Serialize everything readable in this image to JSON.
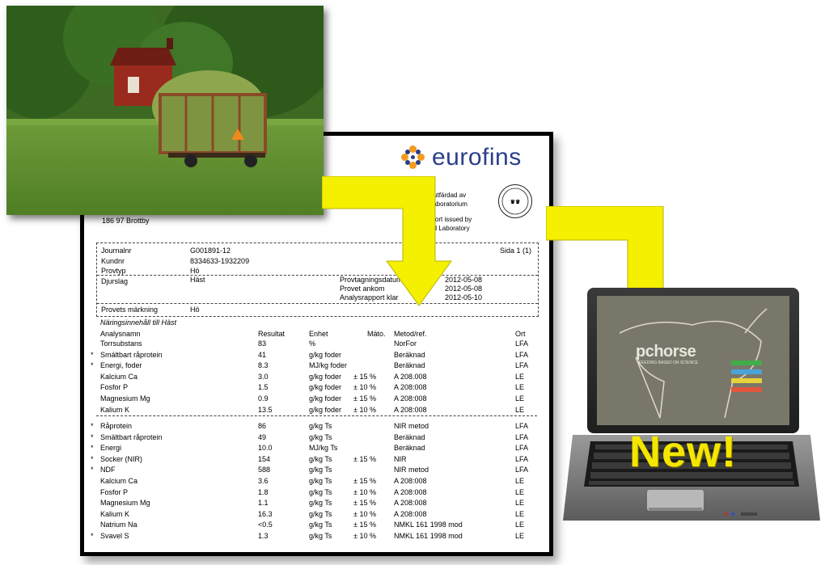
{
  "brand": {
    "name": "eurofins",
    "accreditation_text": [
      "rt utfärdad av",
      "t laboratorium",
      "pport issued by",
      "ted Laboratory"
    ],
    "seal_text": "SWEDAC ACKREDITERING",
    "address": "186 97  Brottby"
  },
  "header": {
    "page": "Sida 1 (1)",
    "rows": [
      {
        "label": "Journalnr",
        "value": "G001891-12"
      },
      {
        "label": "Kundnr",
        "value": "8334633-1932209"
      },
      {
        "label": "Provtyp",
        "value": "Hö"
      },
      {
        "label": "Djurslag",
        "value": "Häst"
      }
    ],
    "dates": [
      {
        "label": "Provtagningsdatum",
        "value": "2012-05-08"
      },
      {
        "label": "Provet ankom",
        "value": "2012-05-08"
      },
      {
        "label": "Analysrapport klar",
        "value": "2012-05-10"
      }
    ],
    "marking_label": "Provets märkning",
    "marking_value": "Hö"
  },
  "section_title": "Näringsinnehåll till Häst",
  "columns": [
    "Analysnamn",
    "Resultat",
    "Enhet",
    "Mäto.",
    "Metod/ref.",
    "Ort"
  ],
  "group1": [
    {
      "star": "",
      "name": "Torrsubstans",
      "result": "83",
      "unit": "%",
      "mato": "",
      "method": "NorFor",
      "ort": "LFA"
    },
    {
      "star": "*",
      "name": "Smältbart råprotein",
      "result": "41",
      "unit": "g/kg foder",
      "mato": "",
      "method": "Beräknad",
      "ort": "LFA"
    },
    {
      "star": "*",
      "name": "Energi, foder",
      "result": "8.3",
      "unit": "MJ/kg foder",
      "mato": "",
      "method": "Beräknad",
      "ort": "LFA"
    },
    {
      "star": "",
      "name": "Kalcium Ca",
      "result": "3.0",
      "unit": "g/kg foder",
      "mato": "± 15 %",
      "method": "A 208.008",
      "ort": "LE"
    },
    {
      "star": "",
      "name": "Fosfor P",
      "result": "1.5",
      "unit": "g/kg foder",
      "mato": "± 10 %",
      "method": "A 208:008",
      "ort": "LE"
    },
    {
      "star": "",
      "name": "Magnesium Mg",
      "result": "0.9",
      "unit": "g/kg foder",
      "mato": "± 15 %",
      "method": "A 208:008",
      "ort": "LE"
    },
    {
      "star": "",
      "name": "Kalium K",
      "result": "13.5",
      "unit": "g/kg foder",
      "mato": "± 10 %",
      "method": "A 208:008",
      "ort": "LE"
    }
  ],
  "group2": [
    {
      "star": "*",
      "name": "Råprotein",
      "result": "86",
      "unit": "g/kg Ts",
      "mato": "",
      "method": "NIR metod",
      "ort": "LFA"
    },
    {
      "star": "*",
      "name": "Smältbart råprotein",
      "result": "49",
      "unit": "g/kg Ts",
      "mato": "",
      "method": "Beräknad",
      "ort": "LFA"
    },
    {
      "star": "*",
      "name": "Energi",
      "result": "10.0",
      "unit": "MJ/kg Ts",
      "mato": "",
      "method": "Beräknad",
      "ort": "LFA"
    },
    {
      "star": "*",
      "name": "Socker (NIR)",
      "result": "154",
      "unit": "g/kg Ts",
      "mato": "± 15 %",
      "method": "NIR",
      "ort": "LFA"
    },
    {
      "star": "*",
      "name": "NDF",
      "result": "588",
      "unit": "g/kg Ts",
      "mato": "",
      "method": "NIR metod",
      "ort": "LFA"
    },
    {
      "star": "",
      "name": "Kalcium Ca",
      "result": "3.6",
      "unit": "g/kg Ts",
      "mato": "± 15 %",
      "method": "A 208:008",
      "ort": "LE"
    },
    {
      "star": "",
      "name": "Fosfor P",
      "result": "1.8",
      "unit": "g/kg Ts",
      "mato": "± 10 %",
      "method": "A 208:008",
      "ort": "LE"
    },
    {
      "star": "",
      "name": "Magnesium Mg",
      "result": "1.1",
      "unit": "g/kg Ts",
      "mato": "± 15 %",
      "method": "A 208:008",
      "ort": "LE"
    },
    {
      "star": "",
      "name": "Kalium K",
      "result": "16.3",
      "unit": "g/kg Ts",
      "mato": "± 10 %",
      "method": "A 208:008",
      "ort": "LE"
    },
    {
      "star": "",
      "name": "Natrium Na",
      "result": "<0.5",
      "unit": "g/kg Ts",
      "mato": "± 15 %",
      "method": "NMKL 161 1998 mod",
      "ort": "LE"
    },
    {
      "star": "*",
      "name": "Svavel S",
      "result": "1.3",
      "unit": "g/kg Ts",
      "mato": "± 10 %",
      "method": "NMKL 161 1998 mod",
      "ort": "LE"
    }
  ],
  "laptop": {
    "app_logo": "pchorse",
    "app_tagline": "FEEDING BASED ON SCIENCE",
    "badge": "New!",
    "menu_colors": [
      "#3fae49",
      "#4aa3d8",
      "#e8d23a",
      "#e2563d"
    ]
  },
  "colors": {
    "arrow": "#f5ef00",
    "eurofins_blue": "#2a3e8a"
  }
}
